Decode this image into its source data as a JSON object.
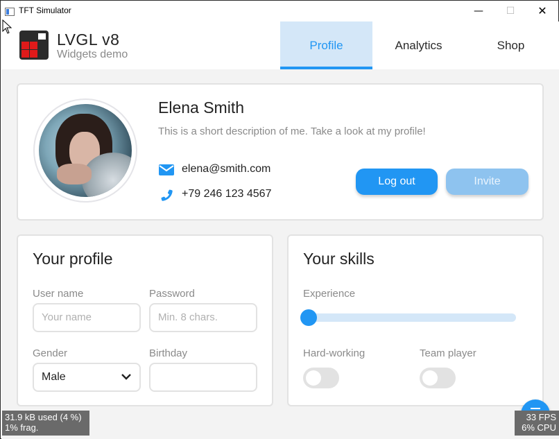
{
  "window": {
    "title": "TFT Simulator",
    "controls": {
      "minimize": "—",
      "maximize": "☐",
      "close": "✕"
    }
  },
  "header": {
    "logo_title": "LVGL v8",
    "logo_subtitle": "Widgets demo",
    "tabs": [
      {
        "label": "Profile",
        "active": true
      },
      {
        "label": "Analytics",
        "active": false
      },
      {
        "label": "Shop",
        "active": false
      }
    ]
  },
  "profile_card": {
    "name": "Elena Smith",
    "description": "This is a short description of me. Take a look at my profile!",
    "email": "elena@smith.com",
    "phone": "+79 246 123 4567",
    "logout_label": "Log out",
    "invite_label": "Invite"
  },
  "your_profile": {
    "title": "Your profile",
    "username_label": "User name",
    "username_placeholder": "Your name",
    "password_label": "Password",
    "password_placeholder": "Min. 8 chars.",
    "gender_label": "Gender",
    "gender_value": "Male",
    "birthday_label": "Birthday",
    "birthday_value": ""
  },
  "your_skills": {
    "title": "Your skills",
    "experience_label": "Experience",
    "experience_value": 0,
    "hard_working_label": "Hard-working",
    "hard_working_on": false,
    "team_player_label": "Team player",
    "team_player_on": false
  },
  "stats": {
    "mem_line1": "31.9 kB used (4 %)",
    "mem_line2": "1% frag.",
    "fps_line1": "33 FPS",
    "fps_line2": "6% CPU"
  },
  "colors": {
    "accent": "#2196f3",
    "tab_active_bg": "#d4e7f8",
    "invite_bg": "#8ec3ef",
    "logo_red": "#e01a1a"
  },
  "icons": {
    "email": "envelope-icon",
    "phone": "phone-icon",
    "dropdown": "chevron-down-icon"
  }
}
